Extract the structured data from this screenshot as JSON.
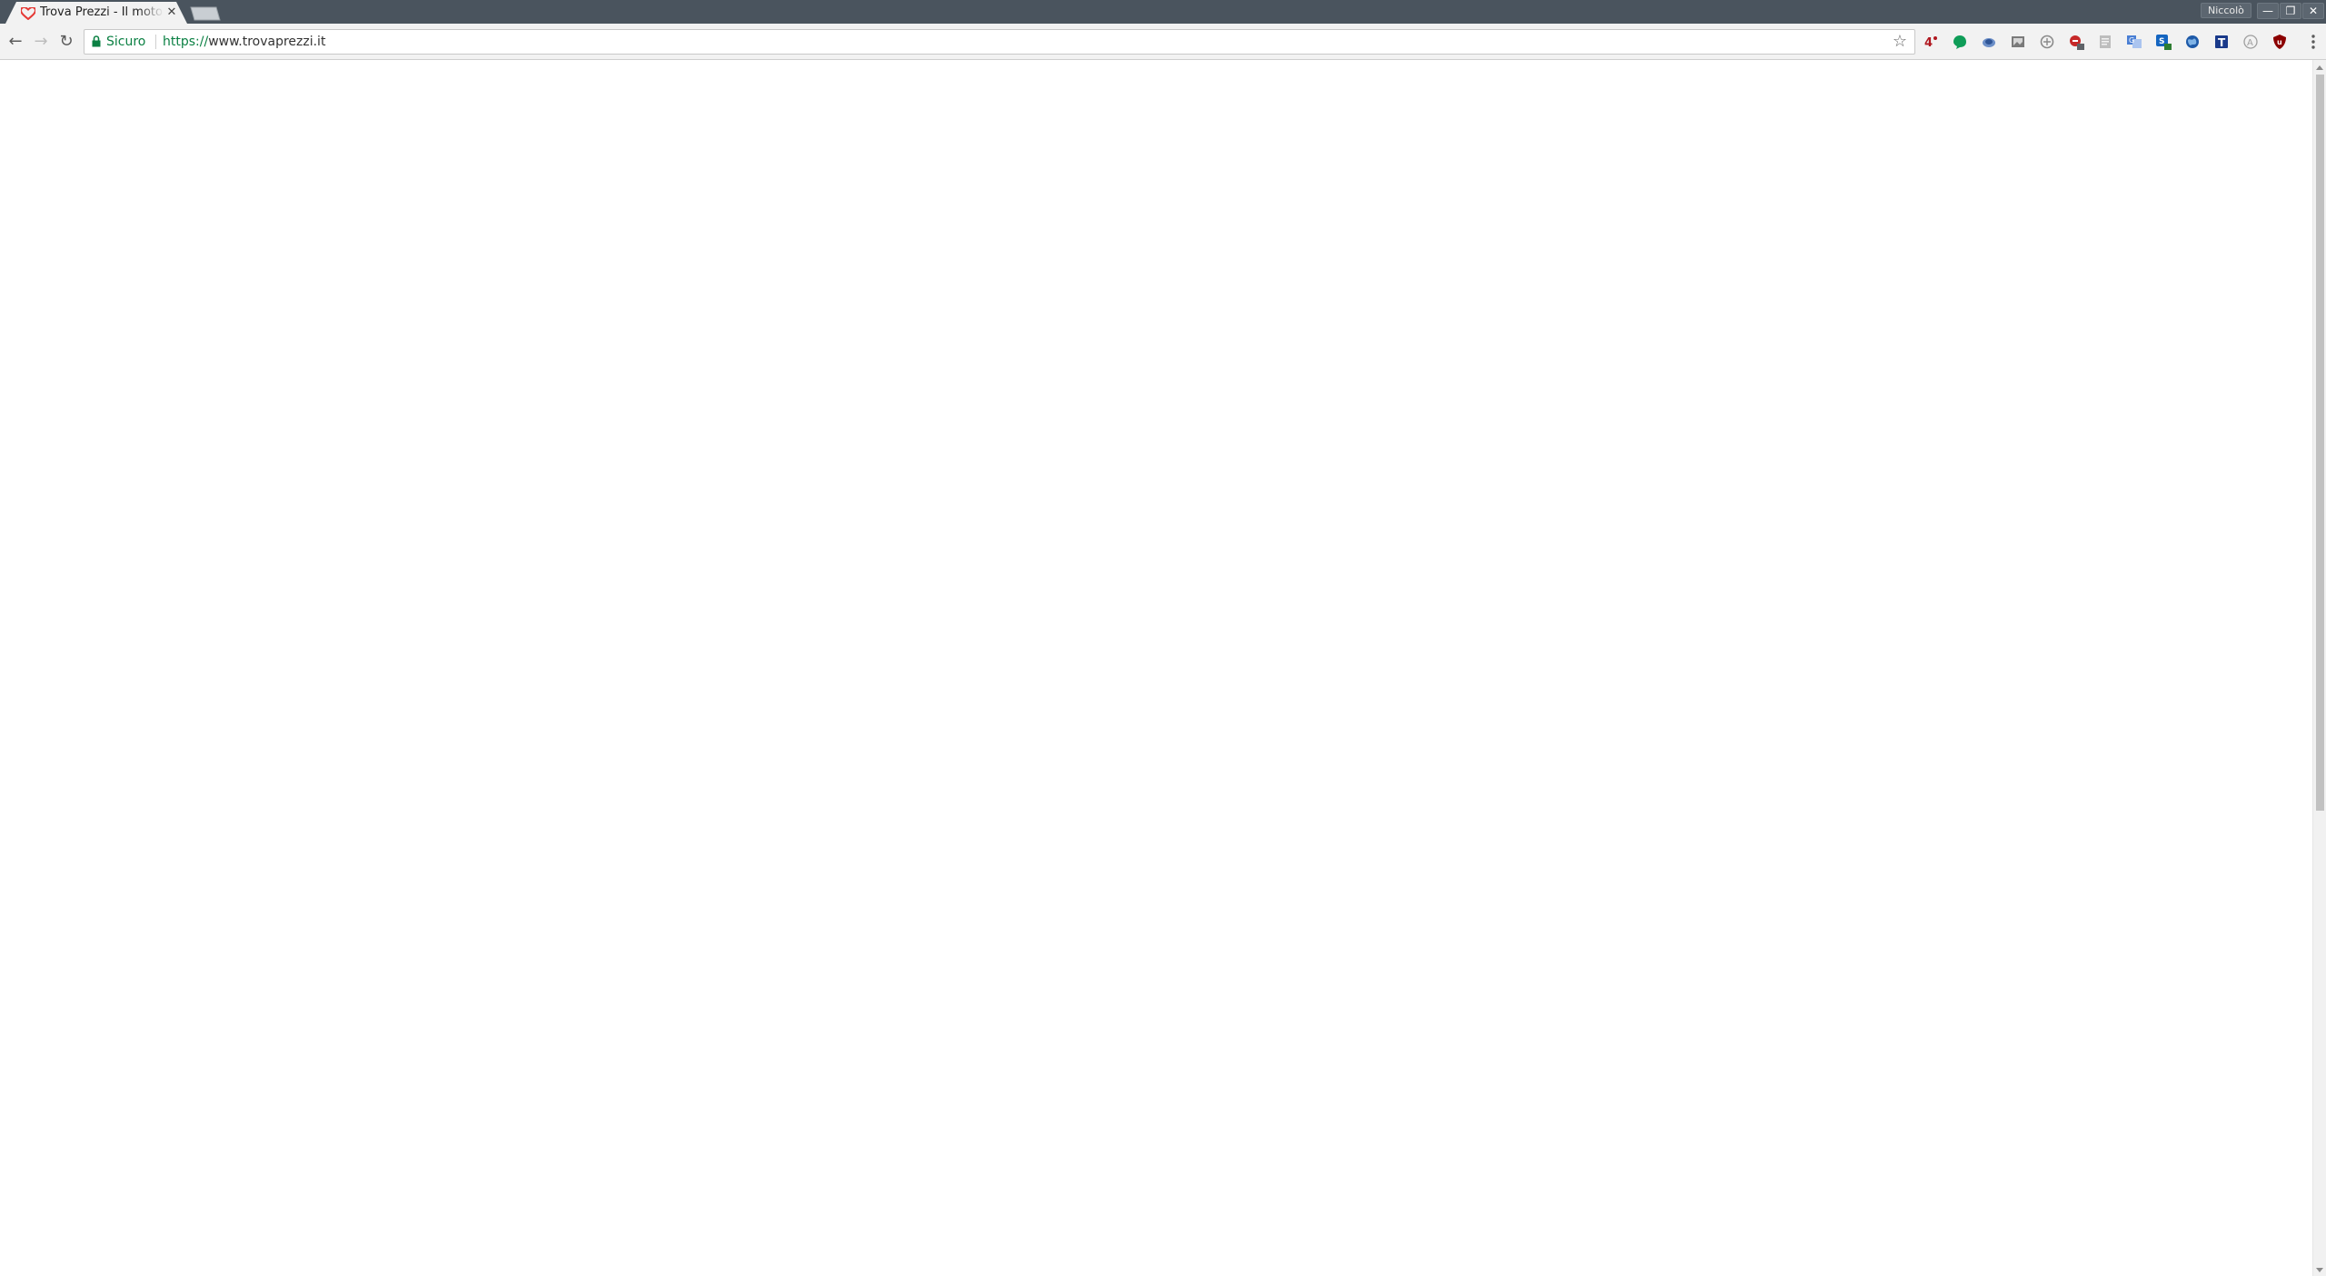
{
  "tab": {
    "title": "Trova Prezzi - Il motore di ricerca",
    "close_glyph": "✕",
    "favicon": "trovaprezzi-heart-icon"
  },
  "profile": {
    "name": "Niccolò"
  },
  "window_controls": {
    "minimize": "—",
    "restore": "❐",
    "close": "✕"
  },
  "nav": {
    "back": "←",
    "forward": "→",
    "reload": "↻"
  },
  "omnibox": {
    "secure_label": "Sicuro",
    "url_scheme": "https://",
    "url_host": "www.trovaprezzi.it",
    "bookmark_glyph": "☆"
  },
  "extensions": [
    {
      "name": "4-ext-icon",
      "text": "4",
      "color": "#b0171f"
    },
    {
      "name": "green-bubble-ext-icon",
      "color": "#0f9d58"
    },
    {
      "name": "blue-swirl-ext-icon",
      "color": "#3b6fb5"
    },
    {
      "name": "photo-ext-icon",
      "color": "#7a7a7a"
    },
    {
      "name": "circle-ext-icon",
      "color": "#8a8a8a"
    },
    {
      "name": "shield-badge-ext-icon",
      "color": "#c62828"
    },
    {
      "name": "doc-ext-icon",
      "color": "#9e9e9e"
    },
    {
      "name": "translate-ext-icon",
      "color": "#4a7fd4"
    },
    {
      "name": "blue-badge-ext-icon",
      "color": "#1565c0"
    },
    {
      "name": "globe-ext-icon",
      "color": "#1e5aa8"
    },
    {
      "name": "t-ext-icon",
      "text": "T",
      "color": "#1a3a8a"
    },
    {
      "name": "a-circle-ext-icon",
      "text": "A",
      "color": "#9e9e9e"
    },
    {
      "name": "ublock-ext-icon",
      "color": "#8b0000"
    }
  ]
}
